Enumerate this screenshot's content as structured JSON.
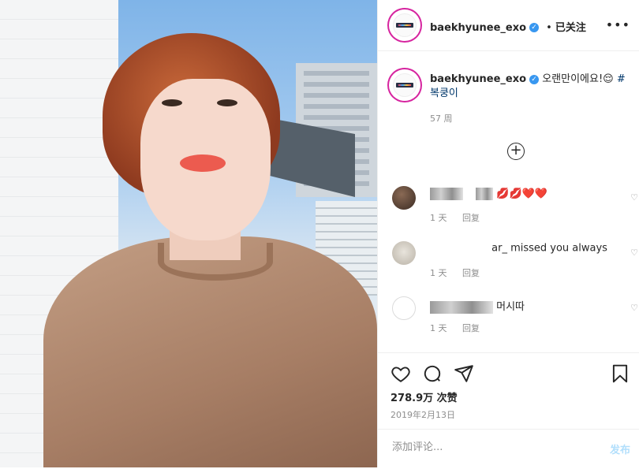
{
  "post": {
    "username": "baekhyunee_exo",
    "verified_icon": "verified-badge-icon",
    "follow_separator": "•",
    "follow_status": "已关注",
    "more_icon": "more-options-icon"
  },
  "caption": {
    "username": "baekhyunee_exo",
    "text": "오랜만이에요!😌",
    "hashtag": "#복쿵이",
    "time": "57 周"
  },
  "load_more_icon": "plus-circle-icon",
  "comments": [
    {
      "text": "💋💋❤️❤️",
      "time": "1 天",
      "reply": "回复"
    },
    {
      "text": "ar_ missed you always",
      "time": "1 天",
      "reply": "回复"
    },
    {
      "text": "머시따",
      "time": "1 天",
      "reply": "回复"
    }
  ],
  "actions": {
    "like_icon": "heart-icon",
    "comment_icon": "comment-icon",
    "share_icon": "send-icon",
    "save_icon": "bookmark-icon"
  },
  "likes": "278.9万 次赞",
  "date": "2019年2月13日",
  "comment_box": {
    "placeholder": "添加评论...",
    "post_label": "发布"
  },
  "colors": {
    "accent": "#3897f0",
    "hashtag": "#00376b",
    "muted": "#8e8e8e",
    "post_disabled": "#b2dffc"
  }
}
